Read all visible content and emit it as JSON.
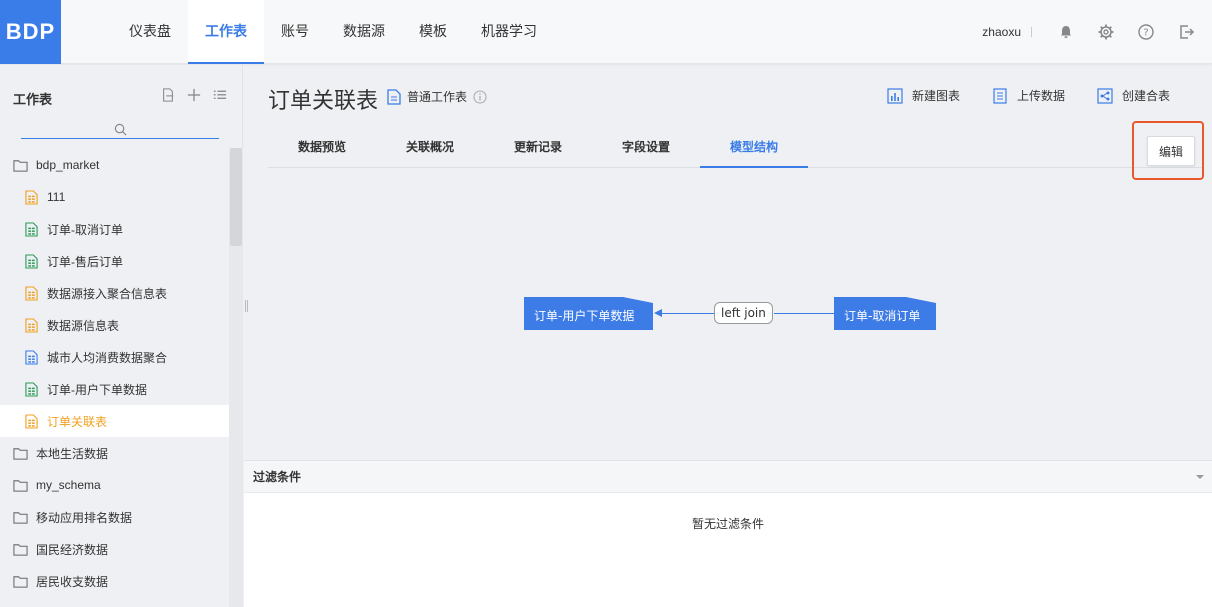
{
  "brand": {
    "logo": "BDP",
    "accent": "#3b7de8"
  },
  "nav": {
    "items": [
      "仪表盘",
      "工作表",
      "账号",
      "数据源",
      "模板",
      "机器学习"
    ],
    "active_index": 1
  },
  "user": {
    "name": "zhaoxu",
    "icons": [
      "bell-icon",
      "gear-icon",
      "help-icon",
      "logout-icon"
    ]
  },
  "sidebar": {
    "title": "工作表",
    "search_placeholder": "",
    "tree": [
      {
        "type": "folder",
        "label": "bdp_market",
        "open": true
      },
      {
        "type": "file",
        "label": "111",
        "color": "#f0a020"
      },
      {
        "type": "file",
        "label": "订单-取消订单",
        "color": "#2e9a5a"
      },
      {
        "type": "file",
        "label": "订单-售后订单",
        "color": "#2e9a5a"
      },
      {
        "type": "file",
        "label": "数据源接入聚合信息表",
        "color": "#f0a020"
      },
      {
        "type": "file",
        "label": "数据源信息表",
        "color": "#f0a020"
      },
      {
        "type": "file",
        "label": "城市人均消费数据聚合",
        "color": "#3b7de8"
      },
      {
        "type": "file",
        "label": "订单-用户下单数据",
        "color": "#2e9a5a"
      },
      {
        "type": "file",
        "label": "订单关联表",
        "color": "#f0a020",
        "active": true
      },
      {
        "type": "folder",
        "label": "本地生活数据"
      },
      {
        "type": "folder",
        "label": "my_schema"
      },
      {
        "type": "folder",
        "label": "移动应用排名数据"
      },
      {
        "type": "folder",
        "label": "国民经济数据"
      },
      {
        "type": "folder",
        "label": "居民收支数据"
      }
    ]
  },
  "main": {
    "title": "订单关联表",
    "subtype": "普通工作表",
    "actions": [
      "新建图表",
      "上传数据",
      "创建合表"
    ],
    "tabs": [
      "数据预览",
      "关联概况",
      "更新记录",
      "字段设置",
      "模型结构"
    ],
    "active_tab": 4,
    "edit_label": "编辑",
    "diagram": {
      "left_node": "订单-用户下单数据",
      "right_node": "订单-取消订单",
      "join": "left join"
    },
    "filter": {
      "title": "过滤条件",
      "empty": "暂无过滤条件"
    }
  }
}
